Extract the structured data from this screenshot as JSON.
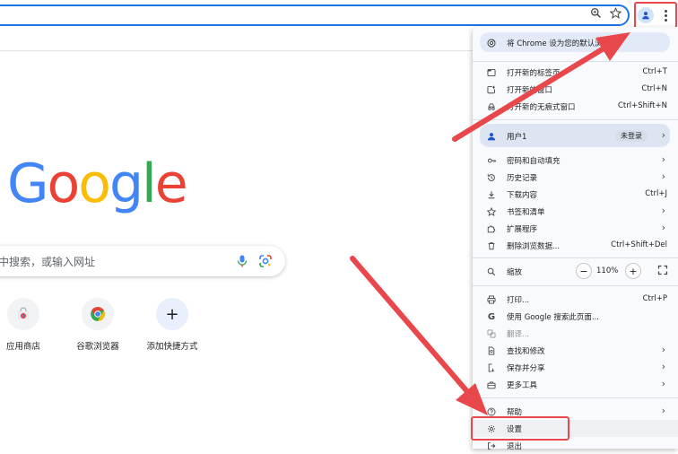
{
  "newtab": {
    "logo_letters": [
      "G",
      "o",
      "o",
      "g",
      "l",
      "e"
    ],
    "logo_colors": [
      "#4285f4",
      "#ea4335",
      "#fbbc05",
      "#4285f4",
      "#34a853",
      "#ea4335"
    ],
    "search_placeholder": "中搜索，或输入网址",
    "shortcuts": [
      {
        "label": "应用商店",
        "icon": "chrome-web-store-icon"
      },
      {
        "label": "谷歌浏览器",
        "icon": "chrome-icon"
      },
      {
        "label": "添加快捷方式",
        "icon": "plus-icon"
      }
    ]
  },
  "menu": {
    "default_browser": "将 Chrome 设为您的默认浏览器",
    "new_tab": {
      "label": "打开新的标签页",
      "shortcut": "Ctrl+T"
    },
    "new_window": {
      "label": "打开新的窗口",
      "shortcut": "Ctrl+N"
    },
    "incognito": {
      "label": "打开新的无痕式窗口",
      "shortcut": "Ctrl+Shift+N"
    },
    "profile": {
      "label": "用户1",
      "badge": "未登录"
    },
    "passwords": "密码和自动填充",
    "history": "历史记录",
    "downloads": {
      "label": "下载内容",
      "shortcut": "Ctrl+J"
    },
    "bookmarks": "书签和清单",
    "extensions": "扩展程序",
    "clear_data": {
      "label": "删除浏览数据...",
      "shortcut": "Ctrl+Shift+Del"
    },
    "zoom": {
      "label": "缩放",
      "value": "110%",
      "minus": "−",
      "plus": "+"
    },
    "print": {
      "label": "打印...",
      "shortcut": "Ctrl+P"
    },
    "search_page": "使用 Google 搜索此页面...",
    "translate": "翻译...",
    "find_edit": "查找和修改",
    "save_share": "保存并分享",
    "more_tools": "更多工具",
    "help": "帮助",
    "settings": "设置",
    "exit": "退出"
  },
  "colors": {
    "accent": "#1a73e8",
    "annotation": "#e8474b",
    "menu_bg": "#f8fafd"
  }
}
